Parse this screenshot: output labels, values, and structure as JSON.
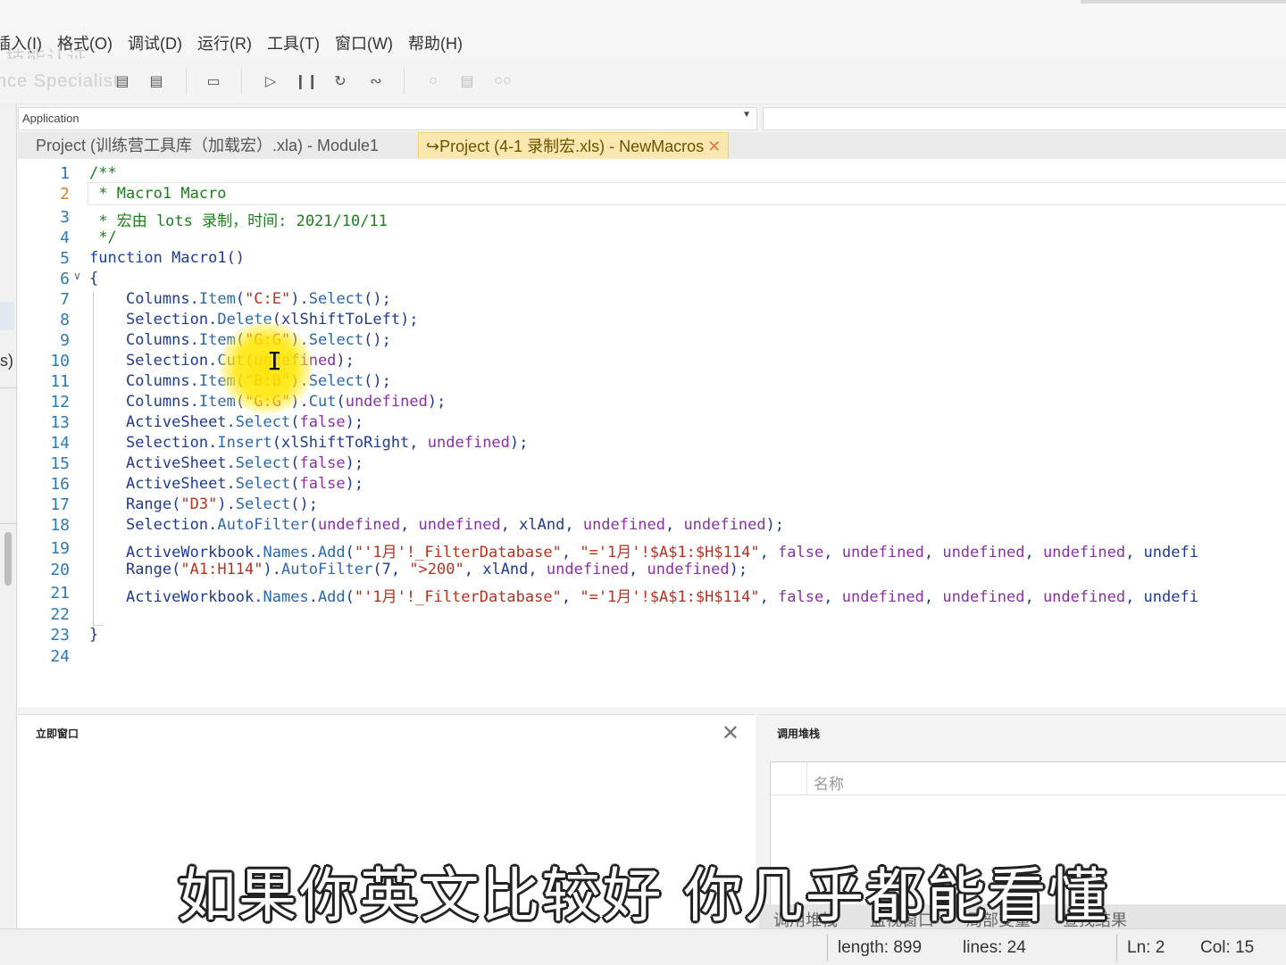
{
  "menu": [
    "插入(I)",
    "格式(O)",
    "调试(D)",
    "运行(R)",
    "工具(T)",
    "窗口(W)",
    "帮助(H)"
  ],
  "watermark": {
    "line1": "技能认证",
    "line2": "nce Specialist"
  },
  "object_box": {
    "value": "Application"
  },
  "tabs": [
    {
      "label": "Project (训练营工具库（加载宏）.xla) - Module1",
      "active": false
    },
    {
      "label": "Project (4-1 录制宏.xls) - NewMacros",
      "active": true,
      "close": "✕"
    }
  ],
  "editor": {
    "active_line": 2,
    "line_numbers": [
      "1",
      "2",
      "3",
      "4",
      "5",
      "6",
      "7",
      "8",
      "9",
      "10",
      "11",
      "12",
      "13",
      "14",
      "15",
      "16",
      "17",
      "18",
      "19",
      "20",
      "21",
      "22",
      "23",
      "24"
    ],
    "lines": [
      "/**",
      " * Macro1 Macro",
      " * 宏由 lots 录制，时间: 2021/10/11",
      " */",
      "function Macro1()",
      "{",
      "    Columns.Item(\"C:E\").Select();",
      "    Selection.Delete(xlShiftToLeft);",
      "    Columns.Item(\"G:G\").Select();",
      "    Selection.Cut(undefined);",
      "    Columns.Item(\"B:B\").Select();",
      "    Columns.Item(\"G:G\").Cut(undefined);",
      "    ActiveSheet.Select(false);",
      "    Selection.Insert(xlShiftToRight, undefined);",
      "    ActiveSheet.Select(false);",
      "    ActiveSheet.Select(false);",
      "    Range(\"D3\").Select();",
      "    Selection.AutoFilter(undefined, undefined, xlAnd, undefined, undefined);",
      "    ActiveWorkbook.Names.Add(\"'1月'!_FilterDatabase\", \"='1月'!$A$1:$H$114\", false, undefined, undefined, undefined, undefi",
      "    Range(\"A1:H114\").AutoFilter(7, \">200\", xlAnd, undefined, undefined);",
      "    ActiveWorkbook.Names.Add(\"'1月'!_FilterDatabase\", \"='1月'!$A$1:$H$114\", false, undefined, undefined, undefined, undefi",
      "",
      "}",
      ""
    ]
  },
  "immediate": {
    "title": "立即窗口",
    "close": "✕"
  },
  "callstack": {
    "title": "调用堆栈",
    "column": "名称",
    "tabs": [
      "调用堆栈",
      "监视窗口",
      "局部变量",
      "查找结果"
    ]
  },
  "status": {
    "length": "length: 899",
    "lines": "lines: 24",
    "ln": "Ln: 2",
    "col": "Col: 15"
  },
  "subtitle": "如果你英文比较好  你几乎都能看懂",
  "colors": {
    "comment": "#1a7f1a",
    "keyword": "#1b3ea8",
    "string": "#b5331f",
    "undefined": "#8b2fa8",
    "line_number": "#2b7ab6",
    "active_tab": "#fbe8b0"
  }
}
